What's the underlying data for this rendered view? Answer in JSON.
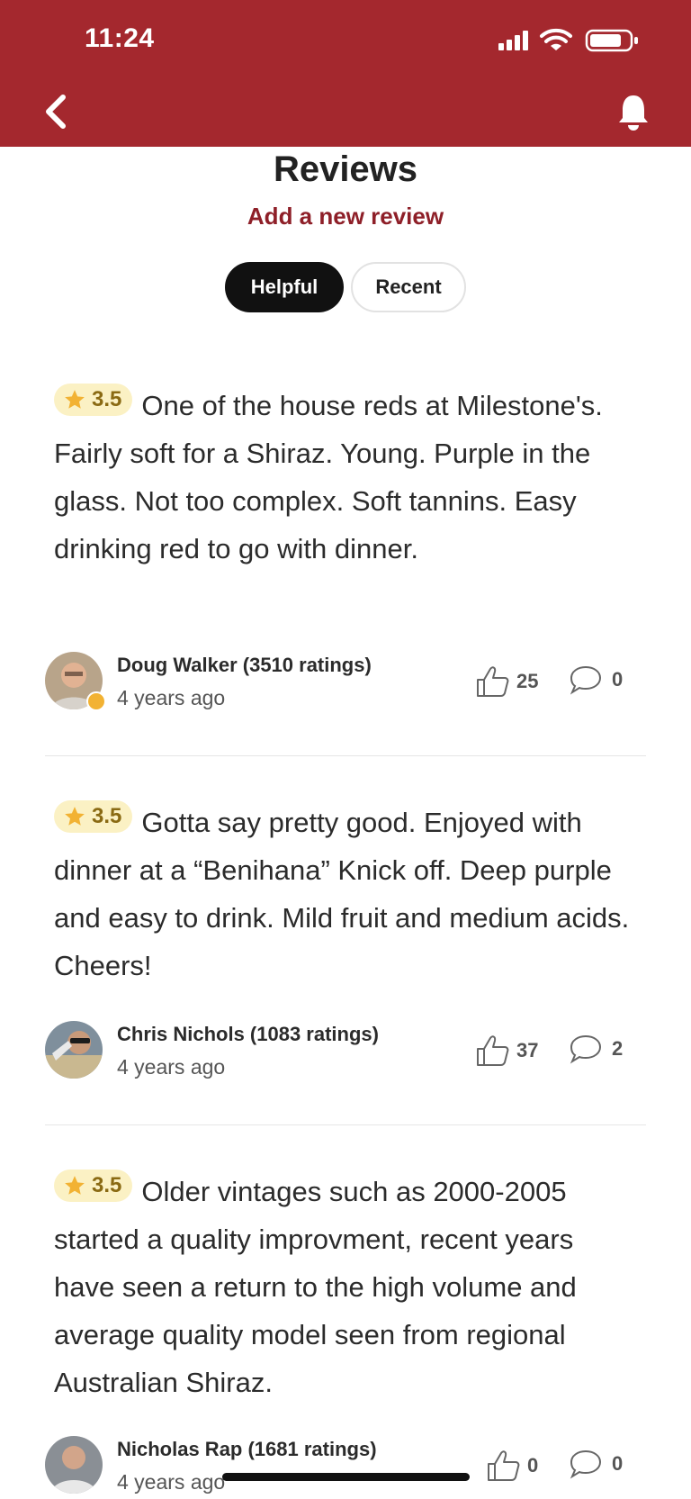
{
  "status_bar": {
    "time": "11:24"
  },
  "header": {
    "title": "Reviews",
    "add_review_label": "Add a new review"
  },
  "filters": [
    {
      "label": "Helpful",
      "selected": true
    },
    {
      "label": "Recent",
      "selected": false
    }
  ],
  "reviews": [
    {
      "rating": "3.5",
      "text": "One of the house reds at Milestone's. Fairly soft for a Shiraz. Young. Purple in the glass. Not too complex. Soft tannins. Easy drinking red to go with dinner.",
      "author": "Doug Walker (3510 ratings)",
      "time": "4 years ago",
      "likes": "25",
      "comments": "0"
    },
    {
      "rating": "3.5",
      "text": "Gotta say pretty good. Enjoyed with dinner at a “Benihana” Knick off. Deep purple and easy to drink. Mild fruit and medium acids. Cheers!",
      "author": "Chris Nichols (1083 ratings)",
      "time": "4 years ago",
      "likes": "37",
      "comments": "2"
    },
    {
      "rating": "3.5",
      "text": "Older vintages such as 2000-2005 started a quality improvment, recent years have seen a return to the high volume and average quality model seen from regional Australian Shiraz.",
      "author": "Nicholas Rap (1681 ratings)",
      "time": "4 years ago",
      "likes": "0",
      "comments": "0"
    }
  ],
  "colors": {
    "brand": "#a4282e",
    "link": "#8e1f28",
    "pill": "#fbf1c4",
    "star": "#f2b233"
  },
  "icons": [
    "back-chevron-icon",
    "bell-icon",
    "star-icon",
    "thumbs-up-icon",
    "comment-icon"
  ]
}
